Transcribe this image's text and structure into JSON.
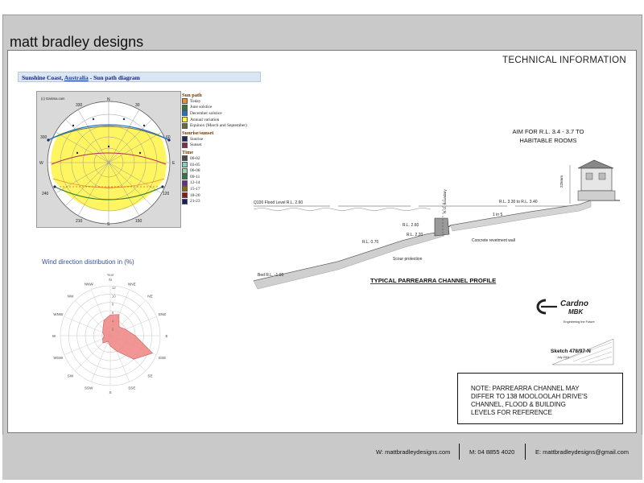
{
  "brand": {
    "name": "matt bradley designs"
  },
  "header": {
    "section_title": "TECHNICAL INFORMATION"
  },
  "sun_path": {
    "title_prefix": "Sunshine Coast, ",
    "title_link": "Australia",
    "title_suffix": " - Sun path diagram",
    "watermark": "(c) Gaisma.com",
    "compass": {
      "N": "N",
      "E": "E",
      "S": "S",
      "W": "W",
      "ne": "30",
      "nw": "330",
      "se": "150",
      "sw": "210"
    },
    "azimuths": {
      "left": "300",
      "right": "60",
      "left_low": "240",
      "right_low": "120"
    },
    "legend": {
      "sun_path_head": "Sun path",
      "sun_path_items": [
        {
          "label": "Today",
          "color": "#f28c28"
        },
        {
          "label": "June solstice",
          "color": "#2e7d32"
        },
        {
          "label": "December solstice",
          "color": "#1e73c8"
        },
        {
          "label": "Annual variation",
          "color": "#fff44f"
        },
        {
          "label": "Equinox (March and September)",
          "color": "#6b6b3a"
        }
      ],
      "sunrise_head": "Sunrise/sunset",
      "sunrise_items": [
        {
          "label": "Sunrise",
          "color": "#1c2a5e"
        },
        {
          "label": "Sunset",
          "color": "#8a2a4a"
        }
      ],
      "time_head": "Time",
      "time_items": [
        {
          "label": "00-02",
          "color": "#4a4a4a"
        },
        {
          "label": "03-05",
          "color": "#7fd1c8"
        },
        {
          "label": "06-08",
          "color": "#9fd1b0"
        },
        {
          "label": "09-11",
          "color": "#2f7a4a"
        },
        {
          "label": "12-14",
          "color": "#6a2a8a"
        },
        {
          "label": "15-17",
          "color": "#8a6a1a"
        },
        {
          "label": "18-20",
          "color": "#8a1a1a"
        },
        {
          "label": "21-23",
          "color": "#1a1a6a"
        }
      ]
    }
  },
  "wind": {
    "title": "Wind direction distribution in (%)",
    "subtitle": "Year",
    "directions": [
      "N",
      "NNE",
      "NE",
      "ENE",
      "E",
      "ESE",
      "SE",
      "SSE",
      "S",
      "SSW",
      "SW",
      "WSW",
      "W",
      "WNW",
      "NW",
      "NNW"
    ],
    "rings": [
      "12",
      "10",
      "8",
      "6",
      "4",
      "2"
    ],
    "values": [
      5,
      5.5,
      3,
      4,
      6,
      11,
      8,
      4,
      2.5,
      1.5,
      2.5,
      2,
      1.5,
      2,
      2.5,
      4
    ]
  },
  "profile": {
    "aim_line1": "AIM FOR R.L. 3.4 - 3.7 TO",
    "aim_line2": "HABITABLE ROOMS",
    "flood_level": "Q100 Flood Level R.L. 2.60",
    "rl_house": "R.L. 3.30 to R.L. 3.40",
    "rl_top": "R.L. 2.60",
    "rl_mid": "R.L. 2.20",
    "rl_low": "R.L. 0.70",
    "bed": "Bed R.L. -1.00",
    "ratio": "1 in 5",
    "wall_label": "Concrete revetment wall",
    "scour": "Scour protection",
    "boundary": "R.O. Boundary",
    "dim": "225mm",
    "caption": "TYPICAL PARREARRA CHANNEL PROFILE"
  },
  "cardno": {
    "line1": "Cardno",
    "line2": "MBK",
    "tagline": "Engineering the Future",
    "sketch": "Sketch 478/97-N",
    "date": "July 2001"
  },
  "note": {
    "lines": [
      "NOTE: PARREARRA CHANNEL MAY",
      "DIFFER TO 138 MOOLOOLAH DRIVE'S",
      "CHANNEL, FLOOD & BUILDING",
      "LEVELS FOR REFERENCE"
    ]
  },
  "footer": {
    "web": "W: mattbradleydesigns.com",
    "mobile": "M: 04 8855 4020",
    "email": "E: mattbradleydesigns@gmail.com"
  },
  "colors": {
    "sun_band": "#fff44f",
    "wind_fill": "#f08a8a",
    "title_bar": "#dbe6f3"
  }
}
